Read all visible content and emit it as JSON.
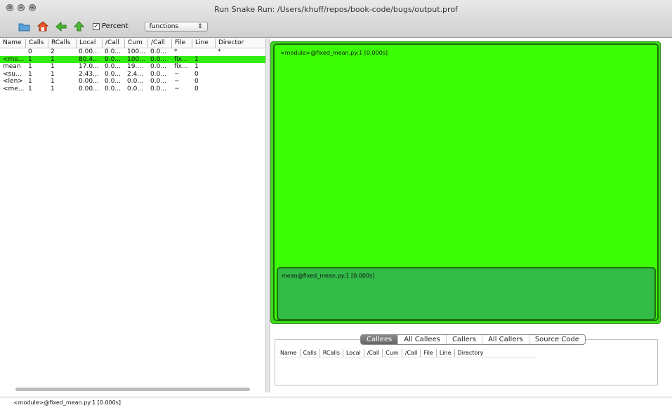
{
  "window": {
    "title": "Run Snake Run: /Users/khuff/repos/book-code/bugs/output.prof",
    "close_glyph": "⊗",
    "minimize_glyph": "⊖",
    "zoom_glyph": "⊕"
  },
  "toolbar": {
    "percent_label": "Percent",
    "percent_checked": true,
    "check_glyph": "✓",
    "view_select": "functions",
    "select_arrow": "⇕",
    "icons": [
      "open-folder-icon",
      "home-icon",
      "back-icon",
      "up-icon"
    ]
  },
  "table": {
    "columns": [
      "Name",
      "Calls",
      "RCalls",
      "Local",
      "/Call",
      "Cum",
      "/Call",
      "File",
      "Line",
      "Directory"
    ],
    "rows": [
      {
        "cells": [
          "",
          "0",
          "2",
          "0.00...",
          "0.0...",
          "100...",
          "0.0...",
          "*",
          "",
          "*"
        ],
        "selected": false
      },
      {
        "cells": [
          "<mo...",
          "1",
          "1",
          "80.4...",
          "0.0...",
          "100...",
          "0.0...",
          "fix...",
          "1",
          ""
        ],
        "selected": true
      },
      {
        "cells": [
          "mean",
          "1",
          "1",
          "17.0...",
          "0.0...",
          "19....",
          "0.0...",
          "fix...",
          "1",
          ""
        ],
        "selected": false
      },
      {
        "cells": [
          "<su...",
          "1",
          "1",
          "2.43...",
          "0.0...",
          "2.4...",
          "0.0...",
          "~",
          "0",
          ""
        ],
        "selected": false
      },
      {
        "cells": [
          "<len>",
          "1",
          "1",
          "0.00...",
          "0.0...",
          "0.0...",
          "0.0...",
          "~",
          "0",
          ""
        ],
        "selected": false
      },
      {
        "cells": [
          "<me...",
          "1",
          "1",
          "0.00...",
          "0.0...",
          "0.0...",
          "0.0...",
          "~",
          "0",
          ""
        ],
        "selected": false
      }
    ]
  },
  "map": {
    "outer_label": "<module>@fixed_mean.py:1 [0.000s]",
    "inner_label": "mean@fixed_mean.py:1 [0.000s]",
    "colors": {
      "outer": "#3dff05",
      "inner": "#33bb48",
      "selection": "#33ee11"
    }
  },
  "lower": {
    "tabs": [
      {
        "label": "Callees",
        "active": true
      },
      {
        "label": "All Callees",
        "active": false
      },
      {
        "label": "Callers",
        "active": false
      },
      {
        "label": "All Callers",
        "active": false
      },
      {
        "label": "Source Code",
        "active": false
      }
    ],
    "columns": [
      "Name",
      "Calls",
      "RCalls",
      "Local",
      "/Call",
      "Cum",
      "/Call",
      "File",
      "Line",
      "Directory"
    ]
  },
  "status": {
    "text": "<module>@fixed_mean.py:1 [0.000s]"
  }
}
